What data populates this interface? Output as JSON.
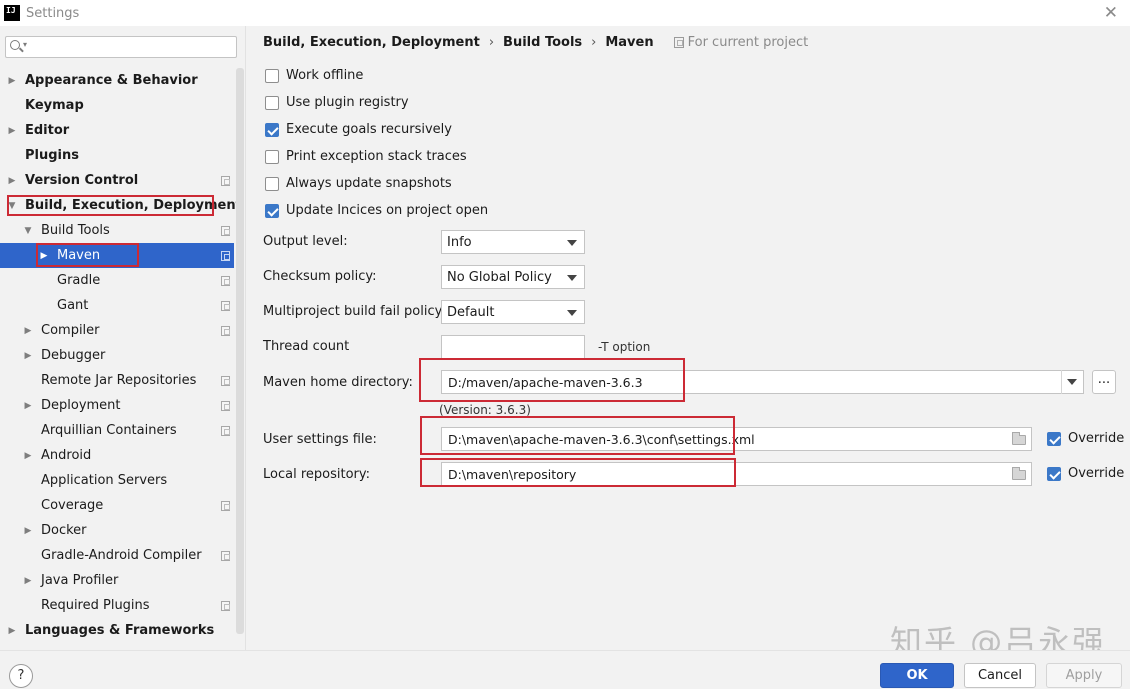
{
  "window": {
    "title": "Settings",
    "logo_text": "IJ"
  },
  "sidebar": {
    "search_placeholder": "",
    "items": [
      {
        "label": "Appearance & Behavior",
        "bold": true,
        "indent": 0,
        "arrow": "right",
        "proj": false
      },
      {
        "label": "Keymap",
        "bold": true,
        "indent": 0,
        "arrow": "",
        "proj": false
      },
      {
        "label": "Editor",
        "bold": true,
        "indent": 0,
        "arrow": "right",
        "proj": false
      },
      {
        "label": "Plugins",
        "bold": true,
        "indent": 0,
        "arrow": "",
        "proj": false
      },
      {
        "label": "Version Control",
        "bold": true,
        "indent": 0,
        "arrow": "right",
        "proj": true
      },
      {
        "label": "Build, Execution, Deployment",
        "bold": true,
        "indent": 0,
        "arrow": "down",
        "proj": false
      },
      {
        "label": "Build Tools",
        "bold": false,
        "indent": 1,
        "arrow": "down",
        "proj": true
      },
      {
        "label": "Maven",
        "bold": false,
        "indent": 2,
        "arrow": "right",
        "proj": true,
        "selected": true
      },
      {
        "label": "Gradle",
        "bold": false,
        "indent": 2,
        "arrow": "",
        "proj": true
      },
      {
        "label": "Gant",
        "bold": false,
        "indent": 2,
        "arrow": "",
        "proj": true
      },
      {
        "label": "Compiler",
        "bold": false,
        "indent": 1,
        "arrow": "right",
        "proj": true
      },
      {
        "label": "Debugger",
        "bold": false,
        "indent": 1,
        "arrow": "right",
        "proj": false
      },
      {
        "label": "Remote Jar Repositories",
        "bold": false,
        "indent": 1,
        "arrow": "",
        "proj": true
      },
      {
        "label": "Deployment",
        "bold": false,
        "indent": 1,
        "arrow": "right",
        "proj": true
      },
      {
        "label": "Arquillian Containers",
        "bold": false,
        "indent": 1,
        "arrow": "",
        "proj": true
      },
      {
        "label": "Android",
        "bold": false,
        "indent": 1,
        "arrow": "right",
        "proj": false
      },
      {
        "label": "Application Servers",
        "bold": false,
        "indent": 1,
        "arrow": "",
        "proj": false
      },
      {
        "label": "Coverage",
        "bold": false,
        "indent": 1,
        "arrow": "",
        "proj": true
      },
      {
        "label": "Docker",
        "bold": false,
        "indent": 1,
        "arrow": "right",
        "proj": false
      },
      {
        "label": "Gradle-Android Compiler",
        "bold": false,
        "indent": 1,
        "arrow": "",
        "proj": true
      },
      {
        "label": "Java Profiler",
        "bold": false,
        "indent": 1,
        "arrow": "right",
        "proj": false
      },
      {
        "label": "Required Plugins",
        "bold": false,
        "indent": 1,
        "arrow": "",
        "proj": true
      },
      {
        "label": "Languages & Frameworks",
        "bold": true,
        "indent": 0,
        "arrow": "right",
        "proj": false
      }
    ]
  },
  "breadcrumb": {
    "items": [
      "Build, Execution, Deployment",
      "Build Tools",
      "Maven"
    ],
    "separator": "›",
    "for_current_project": "For current project"
  },
  "checkboxes": [
    {
      "label": "Work offline",
      "checked": false
    },
    {
      "label": "Use plugin registry",
      "checked": false
    },
    {
      "label": "Execute goals recursively",
      "checked": true
    },
    {
      "label": "Print exception stack traces",
      "checked": false
    },
    {
      "label": "Always update snapshots",
      "checked": false
    },
    {
      "label": "Update Incices on project open",
      "checked": true
    }
  ],
  "fields": {
    "output_level": {
      "label": "Output level:",
      "value": "Info"
    },
    "checksum_policy": {
      "label": "Checksum policy:",
      "value": "No Global Policy"
    },
    "multiproject_policy": {
      "label": "Multiproject build fail policy:",
      "value": "Default"
    },
    "thread_count": {
      "label": "Thread count",
      "value": "",
      "hint": "-T option"
    },
    "maven_home": {
      "label": "Maven home directory:",
      "value": "D:/maven/apache-maven-3.6.3",
      "version": "(Version: 3.6.3)",
      "browse_label": "..."
    },
    "user_settings": {
      "label": "User settings file:",
      "value": "D:\\maven\\apache-maven-3.6.3\\conf\\settings.xml",
      "override_label": "Override",
      "override_checked": true
    },
    "local_repo": {
      "label": "Local repository:",
      "value": "D:\\maven\\repository",
      "override_label": "Override",
      "override_checked": true
    }
  },
  "footer": {
    "help_label": "?",
    "ok_label": "OK",
    "cancel_label": "Cancel",
    "apply_label": "Apply"
  },
  "watermark": "知乎 @吕永强",
  "colors": {
    "accent": "#2f65ca",
    "annotation_red": "#cc2a35",
    "checkbox_blue": "#3b78c8"
  }
}
